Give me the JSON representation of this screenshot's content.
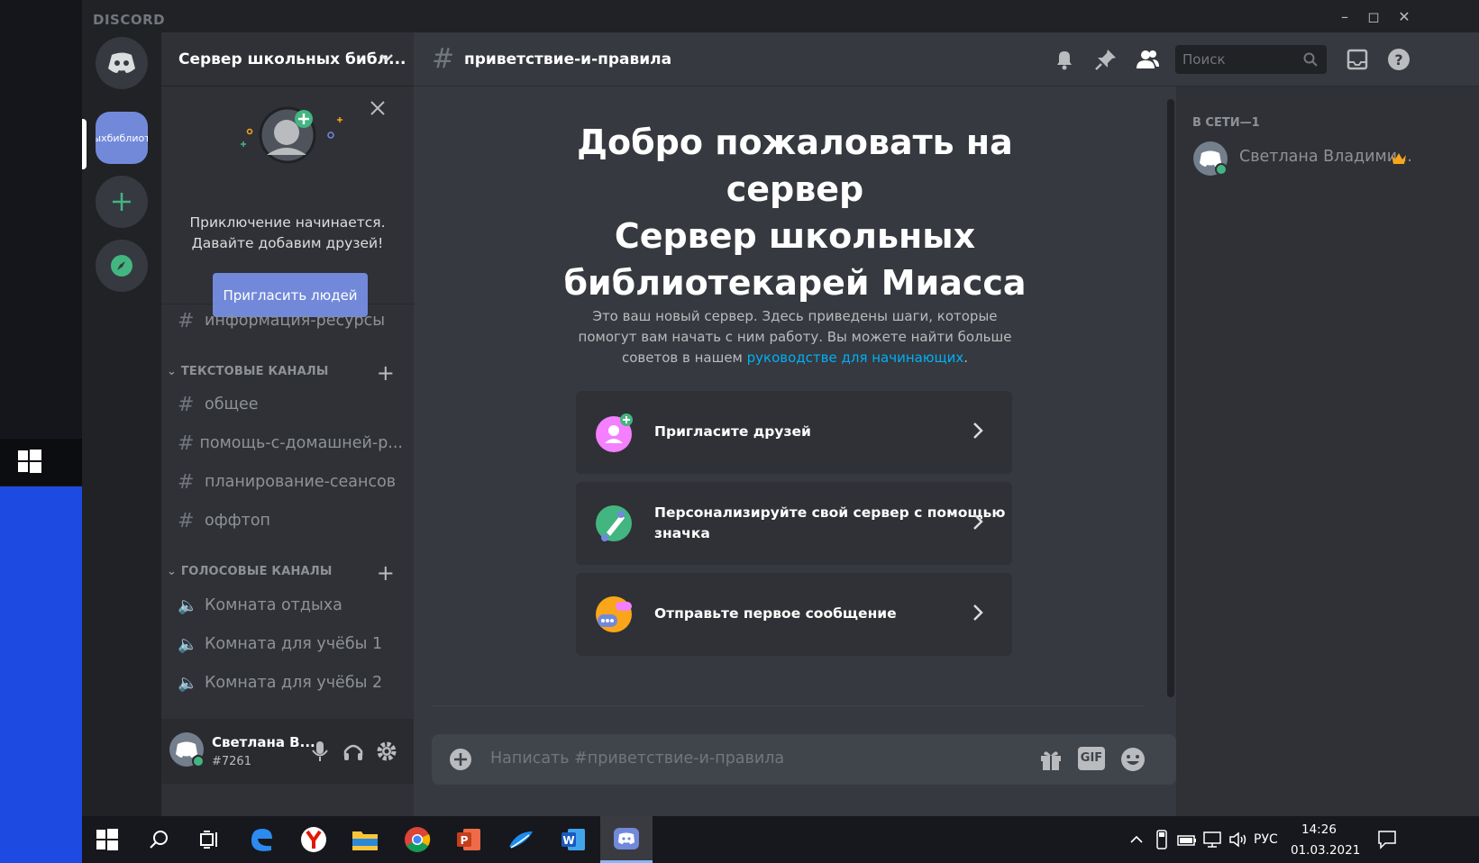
{
  "window": {
    "brand": "DISCORD",
    "controls": [
      "minimize",
      "maximize",
      "close"
    ]
  },
  "rail": {
    "active_server_label": "ыхбиблиот"
  },
  "server": {
    "name": "Сервер школьных библ...",
    "invite_card": {
      "line1": "Приключение начинается.",
      "line2": "Давайте добавим друзей!",
      "button": "Пригласить людей"
    },
    "top_channel": "информация-ресурсы",
    "text_category": "ТЕКСТОВЫЕ КАНАЛЫ",
    "text_channels": [
      "общее",
      "помощь-с-домашней-р...",
      "планирование-сеансов",
      "оффтоп"
    ],
    "voice_category": "ГОЛОСОВЫЕ КАНАЛЫ",
    "voice_channels": [
      "Комната отдыха",
      "Комната для учёбы 1",
      "Комната для учёбы 2"
    ]
  },
  "user": {
    "name": "Светлана В...",
    "tag": "#7261"
  },
  "channel": {
    "name": "приветствие-и-правила",
    "search_placeholder": "Поиск"
  },
  "welcome": {
    "title_line1": "Добро пожаловать на",
    "title_line2": "сервер",
    "title_line3": "Сервер школьных",
    "title_line4": "библиотекарей Миасса",
    "desc_prefix": "Это ваш новый сервер. Здесь приведены шаги, которые помогут вам начать с ним работу. Вы можете найти больше советов в нашем ",
    "desc_link": "руководстве для начинающих",
    "desc_suffix": ".",
    "tasks": [
      "Пригласите друзей",
      "Персонализируйте свой сервер с помощью",
      "значка",
      "Отправьте первое сообщение"
    ]
  },
  "composer": {
    "placeholder": "Написать #приветствие-и-правила",
    "gif": "GIF"
  },
  "members": {
    "category": "В СЕТИ—1",
    "member_name": "Светлана Владими..."
  },
  "taskbar": {
    "lang": "РУС",
    "time": "14:26",
    "date": "01.03.2021"
  },
  "colors": {
    "blurple": "#7289da",
    "online": "#43b581",
    "link": "#00b0f4"
  }
}
